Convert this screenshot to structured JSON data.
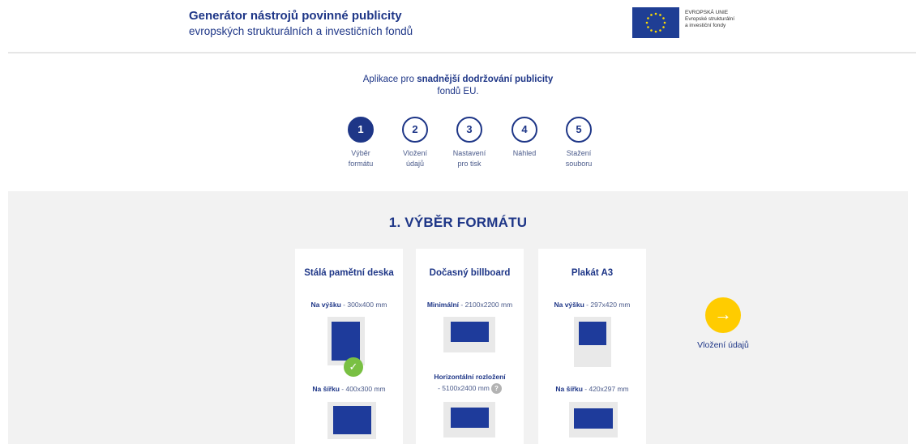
{
  "header": {
    "title": "Generátor nástrojů povinné publicity",
    "subtitle": "evropských strukturálních a investičních fondů",
    "eu_line1": "EVROPSKÁ UNIE",
    "eu_line2": "Evropské strukturální",
    "eu_line3": "a investiční fondy"
  },
  "intro": {
    "prefix": "Aplikace pro ",
    "bold": "snadnější dodržování publicity",
    "suffix": " fondů EU."
  },
  "steps": [
    {
      "number": "1",
      "line1": "Výběr",
      "line2": "formátu",
      "active": true
    },
    {
      "number": "2",
      "line1": "Vložení",
      "line2": "údajů",
      "active": false
    },
    {
      "number": "3",
      "line1": "Nastavení",
      "line2": "pro tisk",
      "active": false
    },
    {
      "number": "4",
      "line1": "Náhled",
      "line2": "",
      "active": false
    },
    {
      "number": "5",
      "line1": "Stažení",
      "line2": "souboru",
      "active": false
    }
  ],
  "section": {
    "title": "1. VÝBĚR FORMÁTU"
  },
  "cards": [
    {
      "title": "Stálá pamětní deska",
      "opt1_bold": "Na výšku",
      "opt1_rest": " - 300x400 mm",
      "opt2_bold": "Na šířku",
      "opt2_rest": " - 400x300 mm",
      "selected": "check-icon"
    },
    {
      "title": "Dočasný billboard",
      "opt1_bold": "Minimální",
      "opt1_rest": " - 2100x2200 mm",
      "opt2_bold": "Horizontální rozložení",
      "opt2_rest": " - 5100x2400 mm",
      "help": "?"
    },
    {
      "title": "Plakát A3",
      "opt1_bold": "Na výšku",
      "opt1_rest": " - 297x420 mm",
      "opt2_bold": "Na šířku",
      "opt2_rest": " - 420x297 mm"
    }
  ],
  "next": {
    "label": "Vložení údajů",
    "icon": "arrow-right-icon"
  },
  "colors": {
    "brand": "#1e3687",
    "accent": "#ffcc00",
    "check": "#79c043"
  }
}
